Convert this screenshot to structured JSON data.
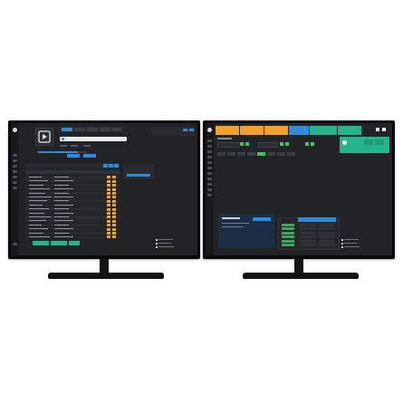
{
  "colors": {
    "screen_bg": "#222326",
    "sidebar_bg": "#19191c",
    "accent_blue": "#2f8ad8",
    "accent_teal": "#25b58d",
    "accent_orange": "#f2a12c",
    "accent_green": "#3fbf66",
    "panel_navy": "#1c2e45"
  },
  "left_screen": {
    "logo_icon": "play-logo-icon",
    "table_rows": 16
  },
  "right_screen": {
    "logo_icon": "play-logo-icon",
    "top_tiles": 6
  }
}
